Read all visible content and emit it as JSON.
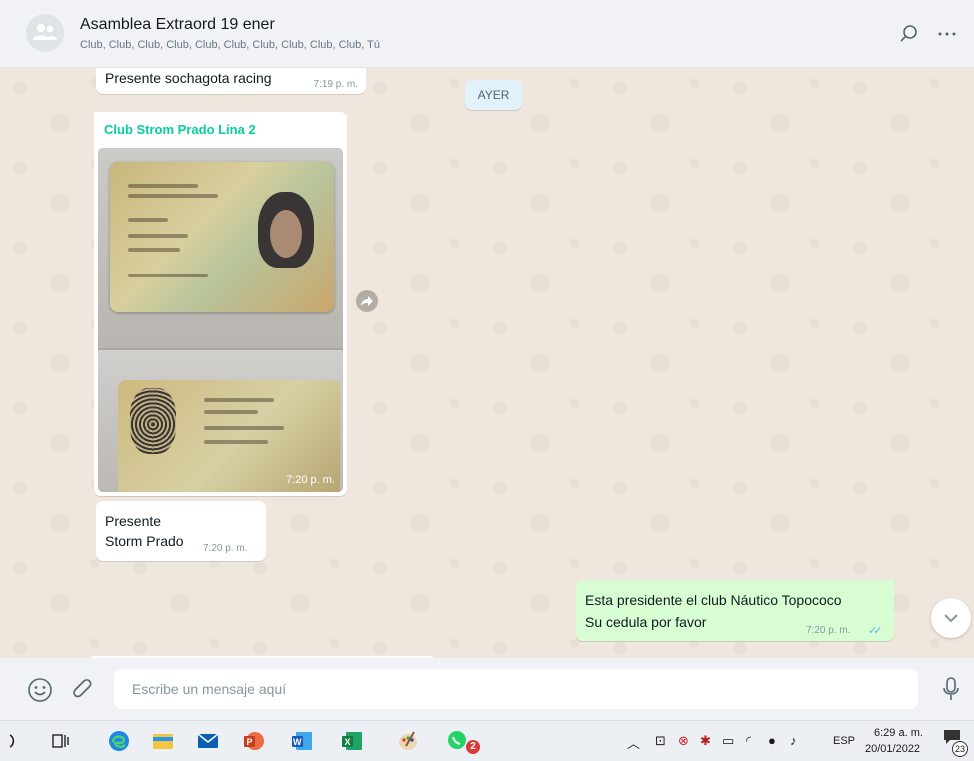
{
  "header": {
    "title": "Asamblea Extraord 19 ener",
    "participants": "Club, Club, Club, Club, Club, Club, Club, Club, Club, Club, Tú"
  },
  "messages": [
    {
      "direction": "in",
      "text": "Presente sochagota racing",
      "time": "7:19 p. m."
    },
    {
      "direction": "in",
      "sender": "Club Strom Prado Lina 2",
      "type": "image",
      "time": "7:20 p. m."
    },
    {
      "direction": "in",
      "lines": [
        "Presente",
        "Storm Prado"
      ],
      "time": "7:20 p. m."
    },
    {
      "direction": "out",
      "lines": [
        "Esta presidente el club Náutico Topococo",
        "Su cedula por favor"
      ],
      "time": "7:20 p. m.",
      "status": "read"
    }
  ],
  "day_divider": "AYER",
  "compose": {
    "placeholder": "Escribe un mensaje aquí"
  },
  "taskbar": {
    "apps": [
      "search-icon",
      "task-view-icon",
      "edge-icon",
      "file-explorer-icon",
      "mail-icon",
      "powerpoint-icon",
      "word-icon",
      "excel-icon",
      "paint-icon",
      "whatsapp-icon"
    ],
    "whatsapp_badge": "2",
    "language": "ESP",
    "time": "6:29 a. m.",
    "date": "20/01/2022",
    "notifications": "23"
  },
  "colors": {
    "sender_name": "#06cf9c",
    "outgoing_bubble": "#d9fdd3",
    "chat_background": "#efe7de",
    "read_ticks": "#53bdeb"
  }
}
